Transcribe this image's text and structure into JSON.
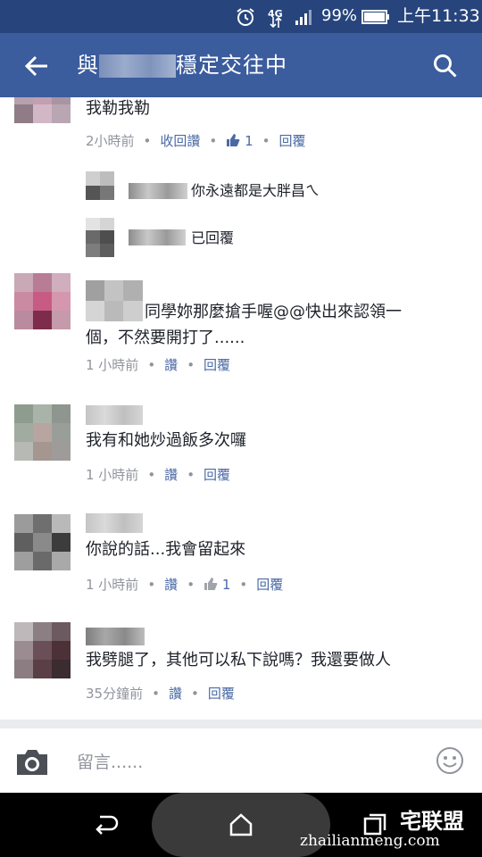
{
  "status": {
    "network": "4G",
    "battery": "99%",
    "time": "上午11:33"
  },
  "header": {
    "title_prefix": "與",
    "title_suffix": "穩定交往中"
  },
  "comments": [
    {
      "text": "我勒我勒",
      "time": "2小時前",
      "actions": [
        "收回讚",
        "1",
        "回覆"
      ]
    },
    {
      "text": "同學妳那麼搶手喔@@快出來認領一個，不然要開打了......",
      "text_line1": "同學妳那麼搶手喔@@快出來認領一",
      "text_line2": "個，不然要開打了......",
      "time": "1 小時前",
      "actions": [
        "讚",
        "回覆"
      ]
    },
    {
      "text": "我有和她炒過飯多次囉",
      "time": "1 小時前",
      "actions": [
        "讚",
        "回覆"
      ]
    },
    {
      "text": "你說的話...我會留起來",
      "time": "1 小時前",
      "actions": [
        "讚",
        "1",
        "回覆"
      ]
    },
    {
      "text": "我劈腿了，其他可以私下說嗎？我還要做人",
      "time": "35分鐘前",
      "actions": [
        "讚",
        "回覆"
      ]
    }
  ],
  "replies": [
    {
      "text": "你永遠都是大胖昌ㄟ"
    },
    {
      "text": "已回覆"
    }
  ],
  "composer": {
    "placeholder": "留言......"
  },
  "watermark": {
    "brand": "宅联盟",
    "url": "zhailianmeng.com"
  },
  "colors": {
    "header": "#3b5c9d",
    "statusbar": "#27457c",
    "link": "#4b6aa5",
    "meta": "#90949c"
  }
}
